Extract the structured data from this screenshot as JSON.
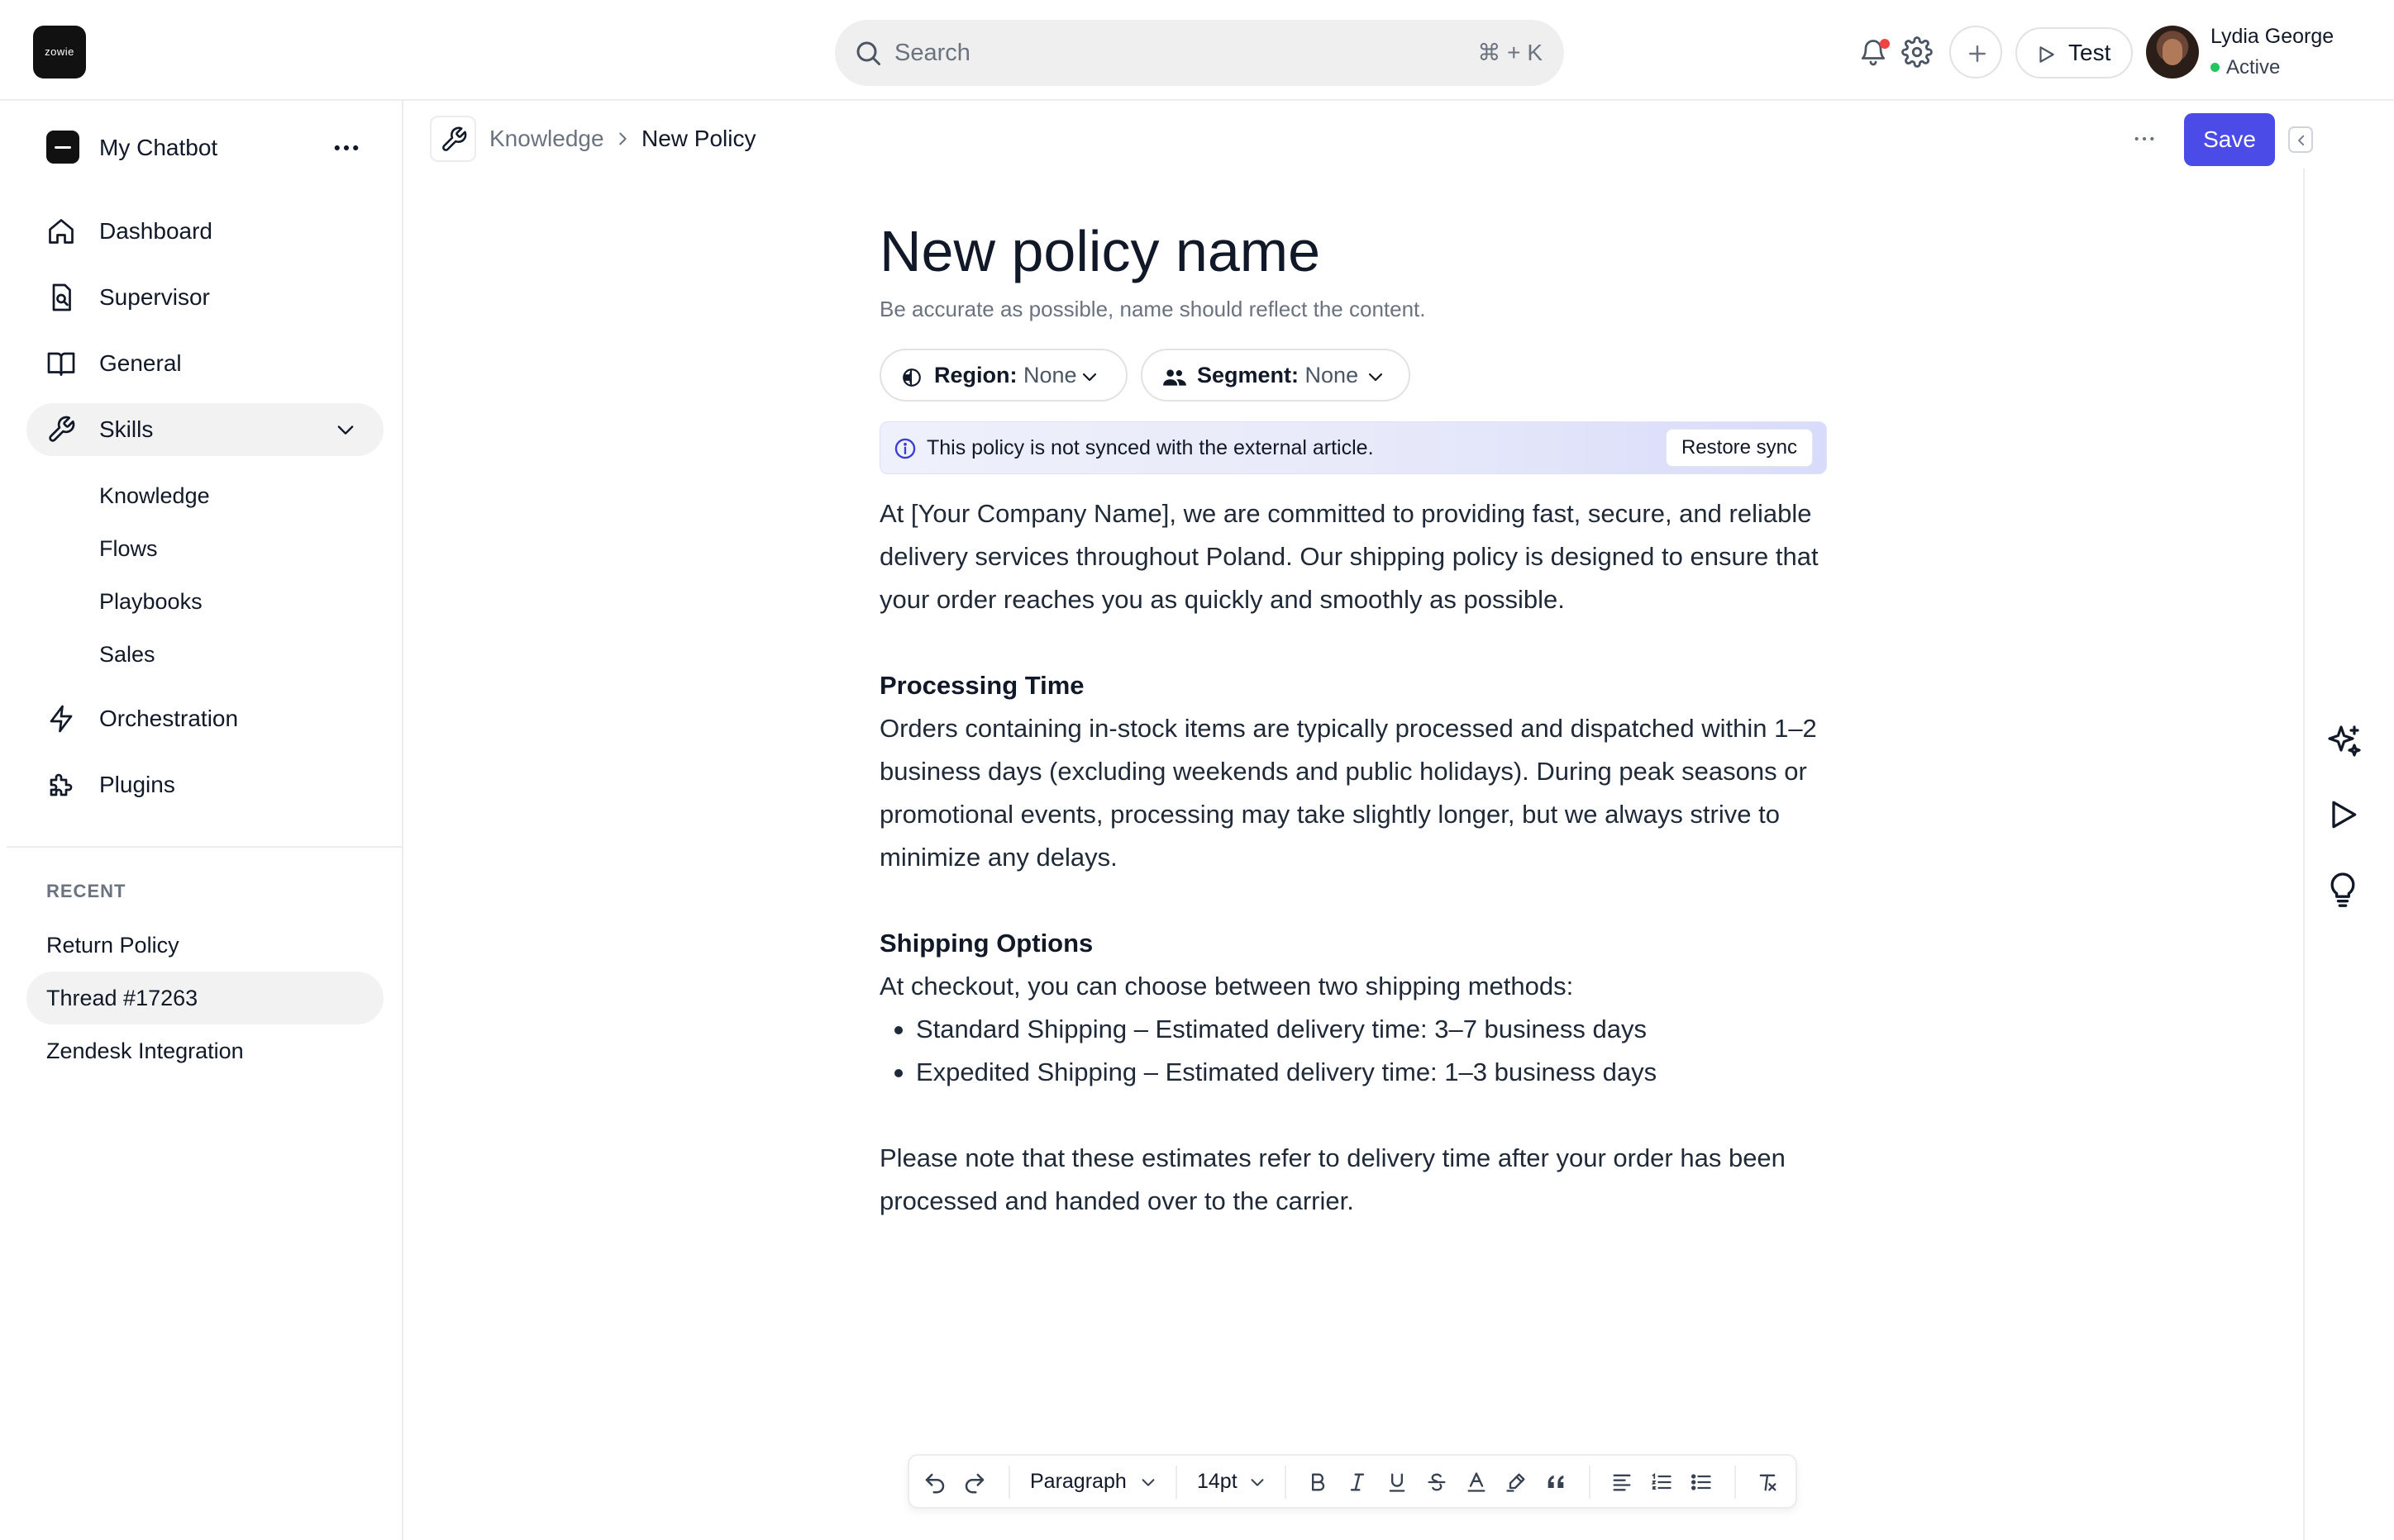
{
  "app": {
    "logo_text": "zowie",
    "search_placeholder": "Search",
    "search_shortcut": "⌘ + K",
    "test_label": "Test",
    "user_name": "Lydia George",
    "user_status": "Active",
    "notification_dot_color": "#ef4444",
    "status_color": "#22c55e"
  },
  "sidebar": {
    "bot_name": "My Chatbot",
    "nav": [
      {
        "label": "Dashboard",
        "icon": "home-icon"
      },
      {
        "label": "Supervisor",
        "icon": "supervisor-icon"
      },
      {
        "label": "General",
        "icon": "book-icon"
      },
      {
        "label": "Skills",
        "icon": "wrench-icon"
      },
      {
        "label": "Orchestration",
        "icon": "bolt-icon"
      },
      {
        "label": "Plugins",
        "icon": "puzzle-icon"
      }
    ],
    "skills_sub": [
      "Knowledge",
      "Flows",
      "Playbooks",
      "Sales"
    ],
    "recent_heading": "RECENT",
    "recent": [
      "Return Policy",
      "Thread #17263",
      "Zendesk Integration"
    ]
  },
  "header": {
    "breadcrumb_parent": "Knowledge",
    "breadcrumb_current": "New Policy",
    "save_label": "Save",
    "accent_color": "#4b4be8"
  },
  "doc": {
    "title": "New policy name",
    "hint": "Be accurate as possible, name should reflect the content.",
    "region_key": "Region:",
    "region_value": "None",
    "segment_key": "Segment:",
    "segment_value": "None",
    "sync_message": "This policy is not synced with the external article.",
    "restore_label": "Restore sync",
    "intro": "At [Your Company Name], we are committed to providing fast, secure, and reliable delivery services throughout Poland. Our shipping policy is designed to ensure that your order reaches you as quickly and smoothly as possible.",
    "processing_heading": "Processing Time",
    "processing_text": "Orders containing in-stock items are typically processed and dispatched within 1–2 business days (excluding weekends and public holidays). During peak seasons or promotional events, processing may take slightly longer, but we always strive to minimize any delays.",
    "shipping_heading": "Shipping Options",
    "shipping_intro": "At checkout, you can choose between two shipping methods:",
    "shipping_items": [
      "Standard Shipping – Estimated delivery time: 3–7 business days",
      "Expedited Shipping – Estimated delivery time: 1–3 business days"
    ],
    "closing": "Please note that these estimates refer to delivery time after your order has been processed and handed over to the carrier."
  },
  "toolbar": {
    "block_style": "Paragraph",
    "font_size": "14pt"
  }
}
